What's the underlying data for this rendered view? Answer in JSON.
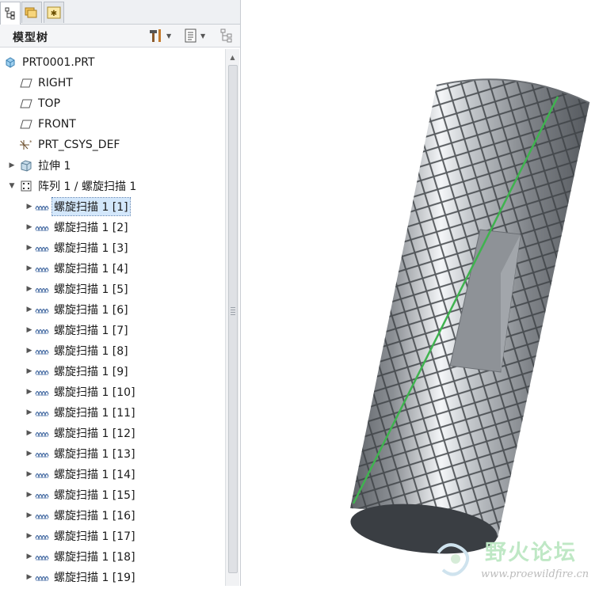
{
  "panel": {
    "header_title": "模型树"
  },
  "tree": {
    "root": "PRT0001.PRT",
    "planes": [
      "RIGHT",
      "TOP",
      "FRONT"
    ],
    "csys": "PRT_CSYS_DEF",
    "extrude": "拉伸 1",
    "pattern": "阵列 1 / 螺旋扫描 1",
    "children": [
      "螺旋扫描 1 [1]",
      "螺旋扫描 1 [2]",
      "螺旋扫描 1 [3]",
      "螺旋扫描 1 [4]",
      "螺旋扫描 1 [5]",
      "螺旋扫描 1 [6]",
      "螺旋扫描 1 [7]",
      "螺旋扫描 1 [8]",
      "螺旋扫描 1 [9]",
      "螺旋扫描 1 [10]",
      "螺旋扫描 1 [11]",
      "螺旋扫描 1 [12]",
      "螺旋扫描 1 [13]",
      "螺旋扫描 1 [14]",
      "螺旋扫描 1 [15]",
      "螺旋扫描 1 [16]",
      "螺旋扫描 1 [17]",
      "螺旋扫描 1 [18]",
      "螺旋扫描 1 [19]"
    ],
    "selected_index": 0
  },
  "watermark": {
    "text": "野火论坛",
    "url": "www.proewildfire.cn"
  },
  "colors": {
    "selection": "#d3e7fb",
    "model_body": "#8e9297",
    "highlight_edge": "#3fb34f",
    "watermark": "#bfe8c5"
  }
}
